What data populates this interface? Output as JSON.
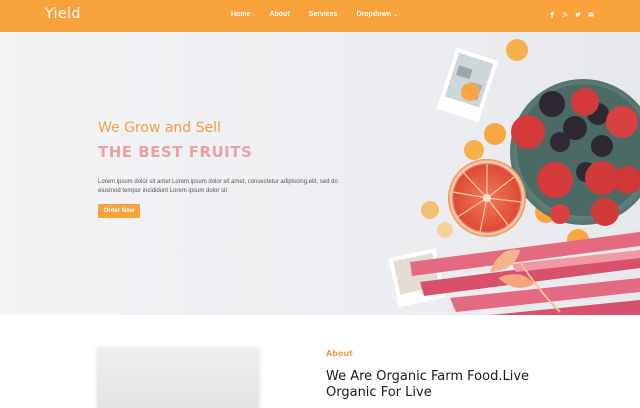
{
  "header": {
    "logo": "Yield",
    "nav": [
      "Home",
      "About",
      "Services",
      "Dropdown"
    ],
    "socials": [
      "facebook-icon",
      "rss-icon",
      "twitter-icon",
      "email-icon"
    ]
  },
  "hero": {
    "subtitle": "We Grow and Sell",
    "title": "THE BEST FRUITS",
    "text": "Lorem ipsum dolor sit amet Lorem ipsum dolor sit amet, consectetur adipiscing elit, sed do eiusmod tempor incididunt Lorem ipsum dolor sit",
    "button": "Order Now"
  },
  "about": {
    "label": "About",
    "title": "We Are Organic Farm Food.Live Organic For Live"
  },
  "colors": {
    "accent": "#f7a23a",
    "title_pink": "#eba0a8",
    "subtitle_orange": "#f0a04a"
  }
}
